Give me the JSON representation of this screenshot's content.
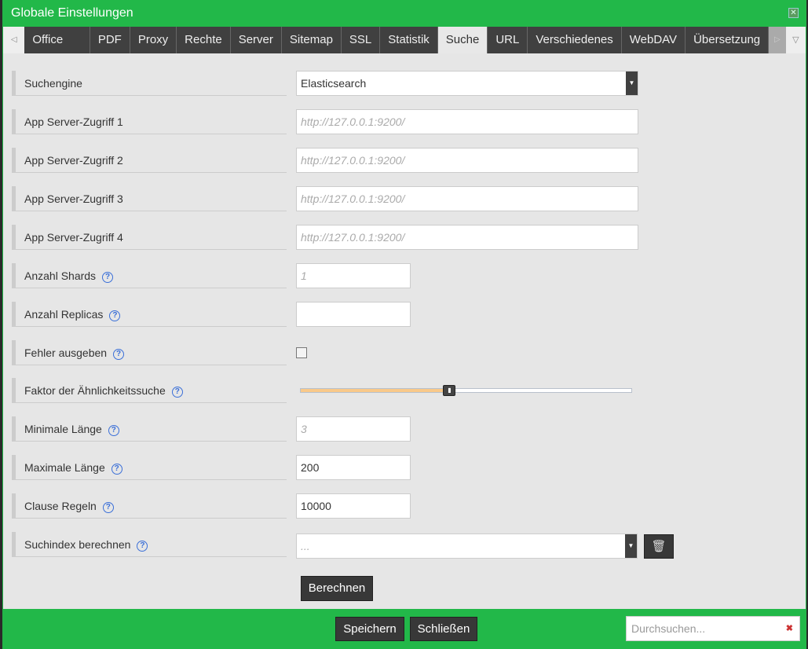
{
  "title": "Globale Einstellungen",
  "tabs": [
    "Office Import",
    "PDF",
    "Proxy",
    "Rechte",
    "Server",
    "Sitemap",
    "SSL",
    "Statistik",
    "Suche",
    "URL",
    "Verschiedenes",
    "WebDAV",
    "Übersetzung"
  ],
  "active_tab": "Suche",
  "fields": {
    "engine": {
      "label": "Suchengine",
      "value": "Elasticsearch"
    },
    "s1": {
      "label": "App Server-Zugriff 1",
      "placeholder": "http://127.0.0.1:9200/"
    },
    "s2": {
      "label": "App Server-Zugriff 2",
      "placeholder": "http://127.0.0.1:9200/"
    },
    "s3": {
      "label": "App Server-Zugriff 3",
      "placeholder": "http://127.0.0.1:9200/"
    },
    "s4": {
      "label": "App Server-Zugriff 4",
      "placeholder": "http://127.0.0.1:9200/"
    },
    "shards": {
      "label": "Anzahl Shards",
      "placeholder": "1"
    },
    "replicas": {
      "label": "Anzahl Replicas",
      "value": ""
    },
    "errors": {
      "label": "Fehler ausgeben",
      "checked": false
    },
    "fuzzy": {
      "label": "Faktor der Ähnlichkeitssuche",
      "slider_percent": 45
    },
    "minlen": {
      "label": "Minimale Länge",
      "placeholder": "3"
    },
    "maxlen": {
      "label": "Maximale Länge",
      "value": "200"
    },
    "clause": {
      "label": "Clause Regeln",
      "value": "10000"
    },
    "index": {
      "label": "Suchindex berechnen",
      "placeholder": "..."
    }
  },
  "help_glyph": "?",
  "compute_button": "Berechnen",
  "footer": {
    "save": "Speichern",
    "close": "Schließen",
    "search_placeholder": "Durchsuchen..."
  },
  "colors": {
    "header": "#22b849",
    "tabs": "#404040",
    "slider_fill": "#f9c98a"
  }
}
